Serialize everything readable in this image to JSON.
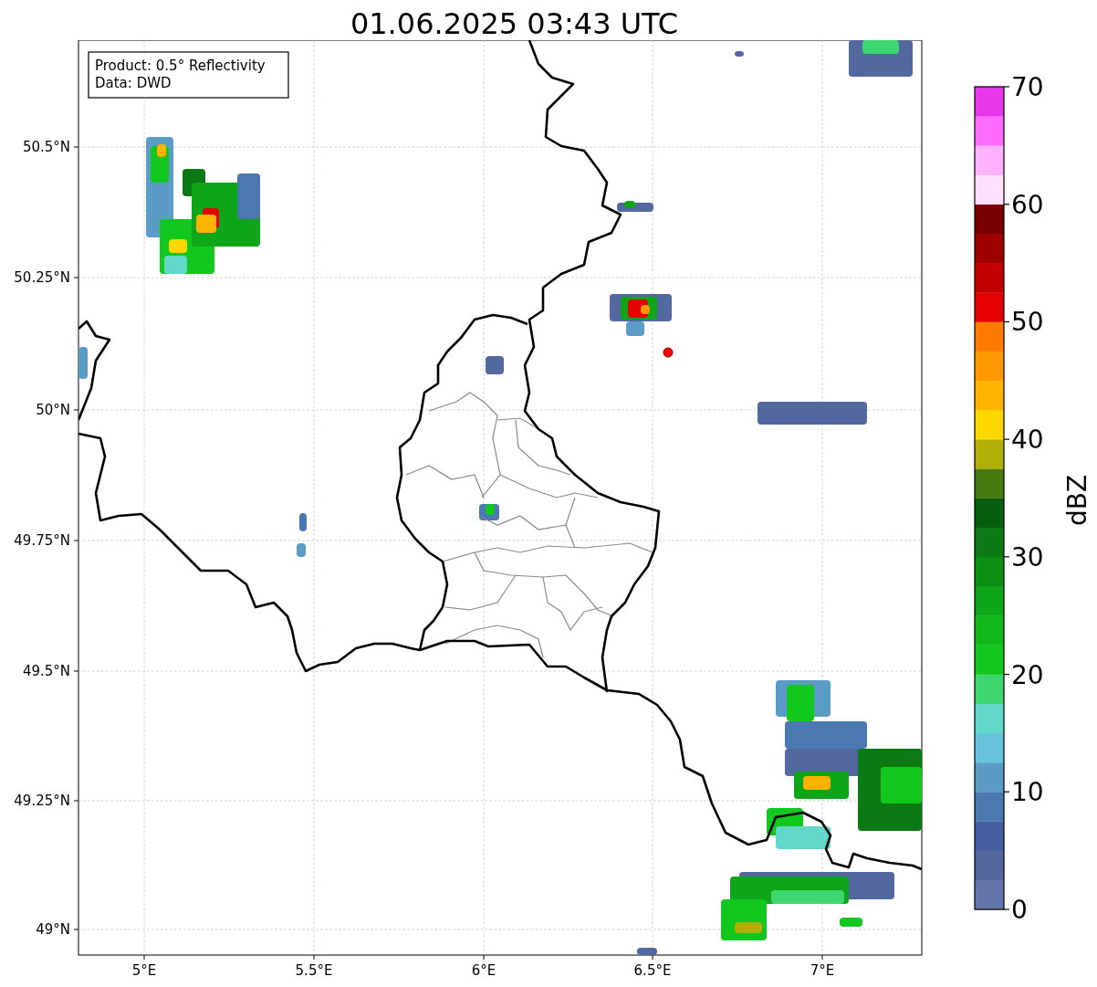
{
  "title": "01.06.2025 03:43 UTC",
  "legend": [
    "Product: 0.5° Reflectivity",
    "Data: DWD"
  ],
  "x_ticks": [
    "5°E",
    "5.5°E",
    "6°E",
    "6.5°E",
    "7°E"
  ],
  "y_ticks": [
    "50.5°N",
    "50.25°N",
    "50°N",
    "49.75°N",
    "49.5°N",
    "49.25°N",
    "49°N"
  ],
  "colorbar": {
    "label": "dBZ",
    "ticks": [
      "70",
      "60",
      "50",
      "40",
      "30",
      "20",
      "10",
      "0"
    ],
    "bins": [
      {
        "color": "#6574a8"
      },
      {
        "color": "#5468a0"
      },
      {
        "color": "#445ea0"
      },
      {
        "color": "#4a78b0"
      },
      {
        "color": "#5a9cc6"
      },
      {
        "color": "#68c4dc"
      },
      {
        "color": "#62d8c8"
      },
      {
        "color": "#3ed66e"
      },
      {
        "color": "#12c81e"
      },
      {
        "color": "#10b81c"
      },
      {
        "color": "#0ea618"
      },
      {
        "color": "#0c9014"
      },
      {
        "color": "#0b7a14"
      },
      {
        "color": "#085e10"
      },
      {
        "color": "#467a10"
      },
      {
        "color": "#b0b008"
      },
      {
        "color": "#fed700"
      },
      {
        "color": "#feb400"
      },
      {
        "color": "#fe9a00"
      },
      {
        "color": "#fe7b00"
      },
      {
        "color": "#e40000"
      },
      {
        "color": "#c20000"
      },
      {
        "color": "#a00000"
      },
      {
        "color": "#780000"
      },
      {
        "color": "#fee0fe"
      },
      {
        "color": "#feb2fe"
      },
      {
        "color": "#fe6cfe"
      },
      {
        "color": "#e838ec"
      }
    ]
  }
}
